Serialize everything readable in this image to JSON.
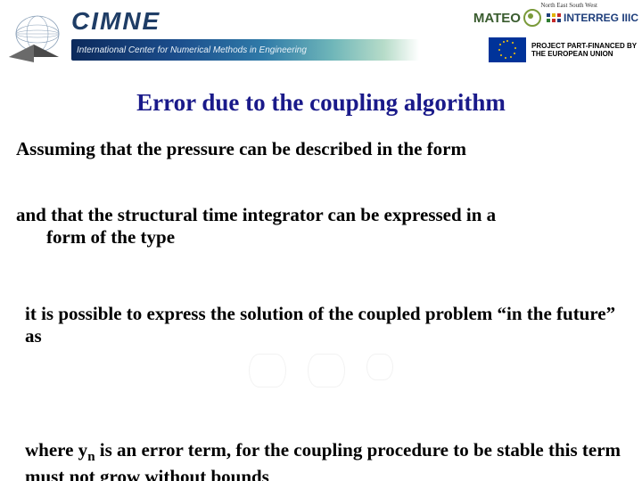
{
  "header": {
    "cimne_title": "CIMNE",
    "cimne_subtitle": "International Center for Numerical Methods in Engineering",
    "mateo_label": "MATEO",
    "interreg_sup": "North East South West",
    "interreg_label": "INTERREG IIIC",
    "eu_text": "PROJECT PART-FINANCED BY THE EUROPEAN UNION"
  },
  "title": "Error due to the coupling algorithm",
  "p1": "Assuming that the pressure can be described in the form",
  "p2_line1": "and that the structural time integrator can be expressed in a",
  "p2_line2": "form of the type",
  "p3": "it is possible to express the solution of the coupled problem “in the future” as",
  "p4_pre": "where y",
  "p4_sub": "n",
  "p4_post": " is an error term, for the coupling procedure to be stable this term must not grow without bounds"
}
